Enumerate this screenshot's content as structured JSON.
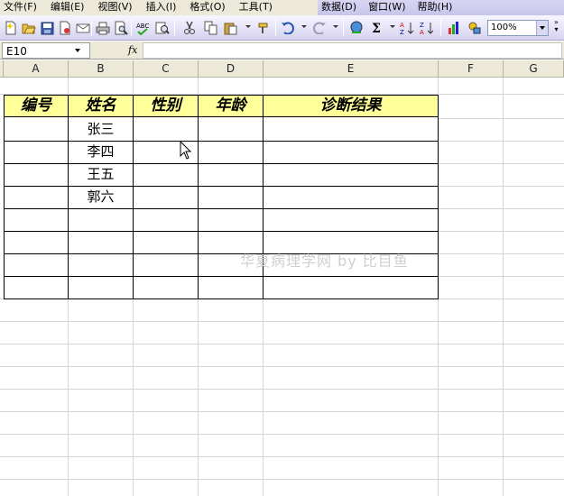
{
  "menu": {
    "items": [
      {
        "label": "文件(F)"
      },
      {
        "label": "编辑(E)"
      },
      {
        "label": "视图(V)"
      },
      {
        "label": "插入(I)"
      },
      {
        "label": "格式(O)"
      },
      {
        "label": "工具(T)"
      },
      {
        "label": "数据(D)"
      },
      {
        "label": "窗口(W)"
      },
      {
        "label": "帮助(H)"
      }
    ]
  },
  "toolbar": {
    "zoom": "100%",
    "icons": [
      "new-icon",
      "open-icon",
      "permission-icon",
      "print-icon",
      "print-preview-icon",
      "spelling-icon",
      "research-icon",
      "cut-icon",
      "copy-icon",
      "paste-icon",
      "format-painter-icon",
      "undo-icon",
      "redo-icon",
      "hyperlink-icon",
      "autosum-icon",
      "sort-ascending-icon",
      "sort-descending-icon",
      "chart-wizard-icon",
      "drawing-icon"
    ]
  },
  "formula_bar": {
    "name_box": "E10",
    "fx": "fx",
    "value": ""
  },
  "columns": [
    "A",
    "B",
    "C",
    "D",
    "E",
    "F",
    "G"
  ],
  "table": {
    "headers": [
      "编号",
      "姓名",
      "性别",
      "年龄",
      "诊断结果"
    ],
    "header_bg": "#ffff99",
    "names": [
      "张三",
      "李四",
      "王五",
      "郭六"
    ]
  },
  "watermark": "华夏病理学网 by 比目鱼"
}
